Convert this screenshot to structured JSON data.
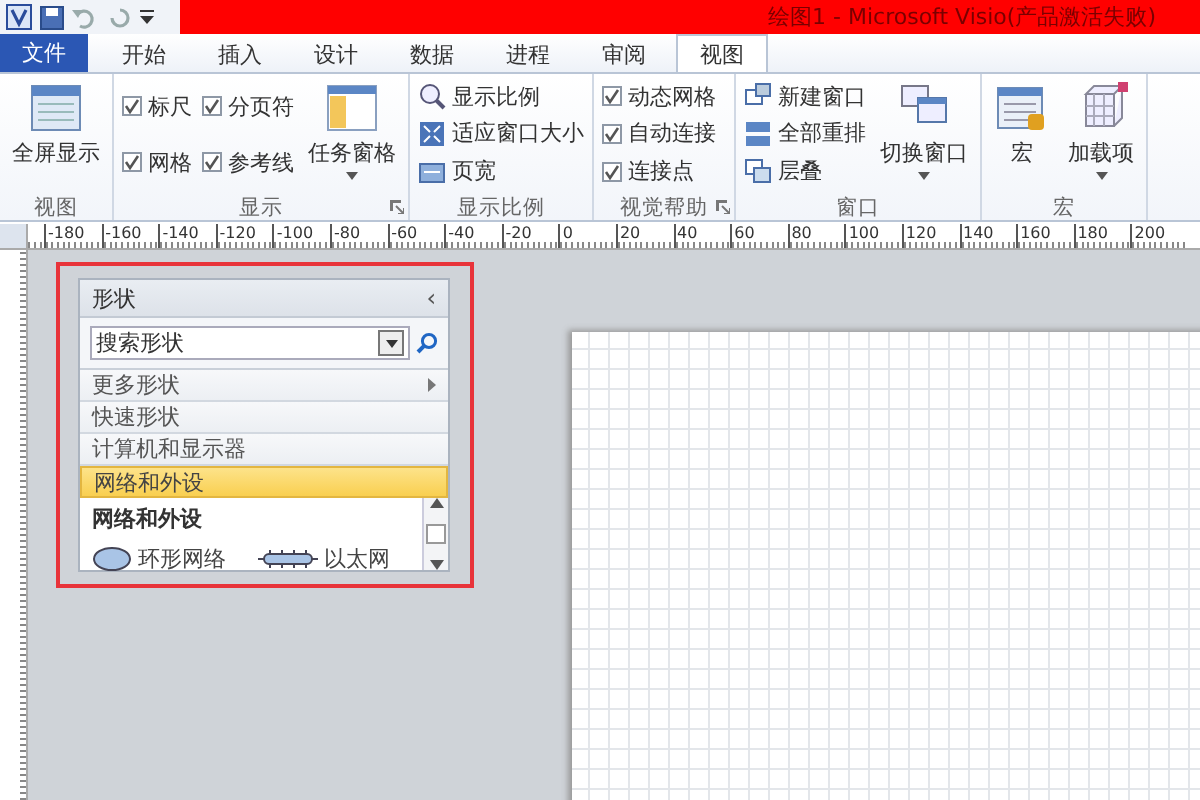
{
  "window": {
    "title": "绘图1 - Microsoft Visio(产品激活失败)"
  },
  "tabs": [
    {
      "label": "文件",
      "kind": "file",
      "selected": false
    },
    {
      "label": "开始",
      "kind": "tab",
      "selected": false
    },
    {
      "label": "插入",
      "kind": "tab",
      "selected": false
    },
    {
      "label": "设计",
      "kind": "tab",
      "selected": false
    },
    {
      "label": "数据",
      "kind": "tab",
      "selected": false
    },
    {
      "label": "进程",
      "kind": "tab",
      "selected": false
    },
    {
      "label": "审阅",
      "kind": "tab",
      "selected": false
    },
    {
      "label": "视图",
      "kind": "tab",
      "selected": true
    }
  ],
  "ribbon_groups": [
    {
      "label": "视图",
      "launcher": false,
      "columns": [
        {
          "kind": "large",
          "label": "全屏显示",
          "dropdown": false
        }
      ]
    },
    {
      "label": "显示",
      "launcher": true,
      "columns": [
        {
          "kind": "stack",
          "items": [
            {
              "kind": "check",
              "label": "标尺",
              "checked": true
            },
            {
              "kind": "check",
              "label": "网格",
              "checked": true
            }
          ]
        },
        {
          "kind": "stack",
          "items": [
            {
              "kind": "check",
              "label": "分页符",
              "checked": true
            },
            {
              "kind": "check",
              "label": "参考线",
              "checked": true
            }
          ]
        },
        {
          "kind": "large",
          "label": "任务窗格",
          "dropdown": true
        }
      ]
    },
    {
      "label": "显示比例",
      "launcher": false,
      "columns": [
        {
          "kind": "stack",
          "items": [
            {
              "kind": "zoom",
              "label": "显示比例"
            },
            {
              "kind": "fit",
              "label": "适应窗口大小"
            },
            {
              "kind": "width",
              "label": "页宽"
            }
          ]
        }
      ]
    },
    {
      "label": "视觉帮助",
      "launcher": true,
      "columns": [
        {
          "kind": "stack",
          "items": [
            {
              "kind": "check",
              "label": "动态网格",
              "checked": true
            },
            {
              "kind": "check",
              "label": "自动连接",
              "checked": true
            },
            {
              "kind": "check",
              "label": "连接点",
              "checked": true
            }
          ]
        }
      ]
    },
    {
      "label": "窗口",
      "launcher": false,
      "columns": [
        {
          "kind": "stack",
          "items": [
            {
              "kind": "newwin",
              "label": "新建窗口"
            },
            {
              "kind": "arrange",
              "label": "全部重排"
            },
            {
              "kind": "cascade",
              "label": "层叠"
            }
          ]
        },
        {
          "kind": "large",
          "label": "切换窗口",
          "dropdown": true
        }
      ]
    },
    {
      "label": "宏",
      "launcher": false,
      "columns": [
        {
          "kind": "large",
          "label": "宏",
          "dropdown": false
        },
        {
          "kind": "large",
          "label": "加载项",
          "dropdown": true
        }
      ]
    }
  ],
  "ruler": [
    "-180",
    "-160",
    "-140",
    "-120",
    "-100",
    "-80",
    "-60",
    "-40",
    "-20",
    "0",
    "20",
    "40",
    "60",
    "80",
    "100",
    "120",
    "140",
    "160",
    "180",
    "200"
  ],
  "shape_panel": {
    "title": "形状",
    "collapse": "‹",
    "search": {
      "placeholder": "搜索形状"
    },
    "categories": [
      {
        "label": "更多形状",
        "kind": "submenu",
        "selected": false
      },
      {
        "label": "快速形状",
        "kind": "item",
        "selected": false
      },
      {
        "label": "计算机和显示器",
        "kind": "item",
        "selected": false
      },
      {
        "label": "网络和外设",
        "kind": "item",
        "selected": true
      }
    ],
    "stencil": {
      "title": "网络和外设",
      "shapes": [
        {
          "kind": "ring",
          "label": "环形网络"
        },
        {
          "kind": "ethernet",
          "label": "以太网"
        }
      ]
    }
  }
}
